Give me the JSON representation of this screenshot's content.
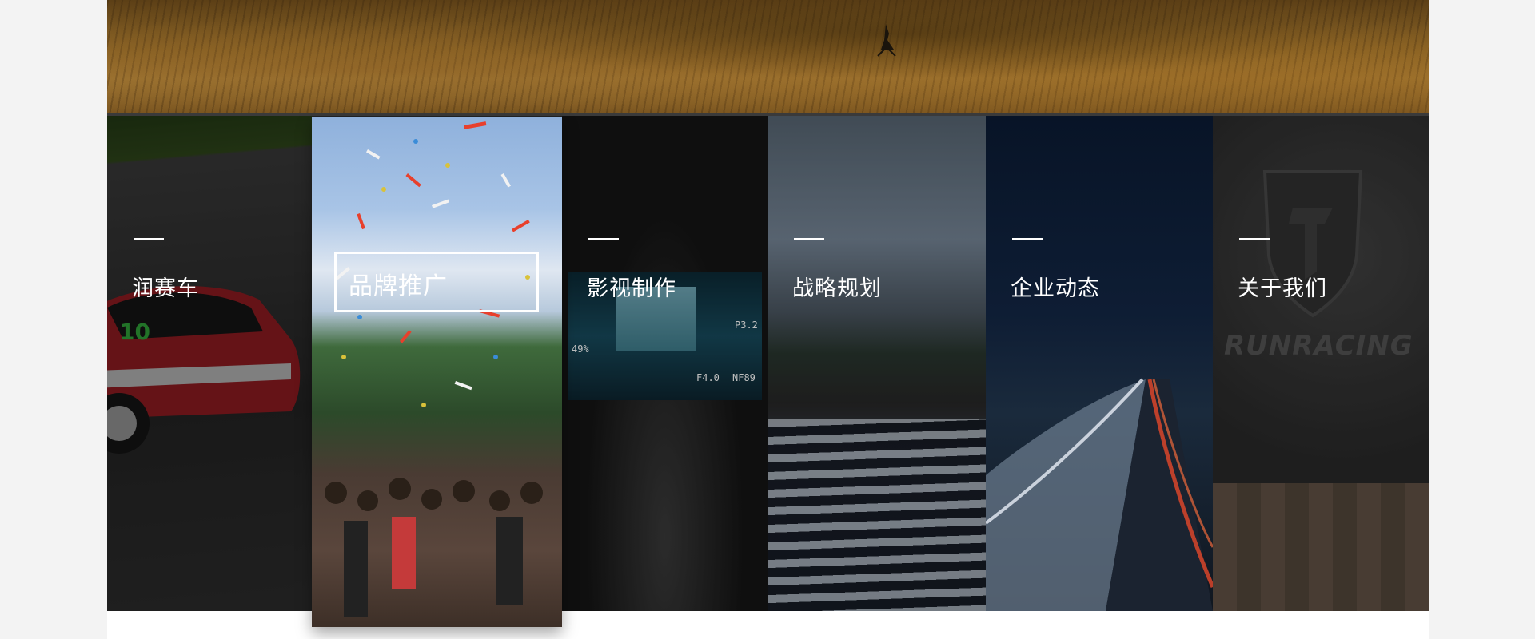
{
  "menu": {
    "items": [
      {
        "id": "runsaiche",
        "label": "润赛车"
      },
      {
        "id": "pinpai",
        "label": "品牌推广"
      },
      {
        "id": "yingshi",
        "label": "影视制作"
      },
      {
        "id": "zhanlue",
        "label": "战略规划"
      },
      {
        "id": "qiye",
        "label": "企业动态"
      },
      {
        "id": "guanyu",
        "label": "关于我们"
      }
    ],
    "active_index": 1
  },
  "images": {
    "car_number": "10",
    "wordmark": "RUNRACING",
    "screen_readout": [
      "P3.2",
      "49%",
      "F4.0",
      "NF89"
    ]
  },
  "colors": {
    "panel_text": "#ffffff",
    "dash": "#ffffff",
    "page_bg": "#ffffff",
    "side_bg": "#f3f3f3"
  }
}
